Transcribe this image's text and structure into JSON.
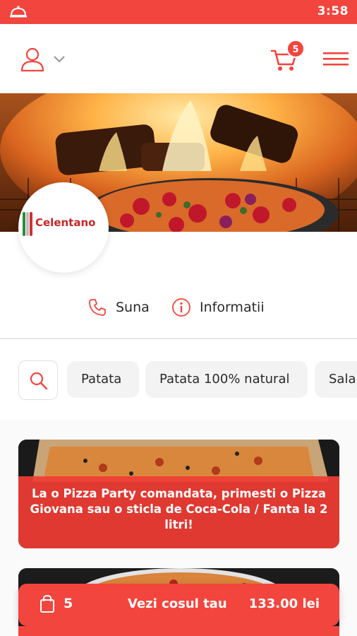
{
  "status_bar": {
    "time": "3:58",
    "app_icon": "cloche-icon",
    "color": "#f2453d"
  },
  "header": {
    "user_icon": "user-icon",
    "dropdown_icon": "chevron-down-icon",
    "cart_icon": "cart-icon",
    "cart_count": "5",
    "menu_icon": "hamburger-menu-icon"
  },
  "restaurant": {
    "logo_text": "Celentano"
  },
  "actions": {
    "call_label": "Suna",
    "info_label": "Informatii"
  },
  "filters": {
    "search_icon": "search-icon",
    "chips": [
      {
        "label": "Patata"
      },
      {
        "label": "Patata 100% natural"
      },
      {
        "label": "Sala"
      }
    ]
  },
  "promo": {
    "text": "La o Pizza Party comandata, primesti o Pizza Giovana sau o sticla de Coca-Cola / Fanta la 2 litri!"
  },
  "cart_bar": {
    "count": "5",
    "view_label": "Vezi cosul tau",
    "total": "133.00 lei"
  },
  "colors": {
    "accent": "#f2453d",
    "chip_bg": "#f3f3f3",
    "text": "#2a2a2a"
  }
}
